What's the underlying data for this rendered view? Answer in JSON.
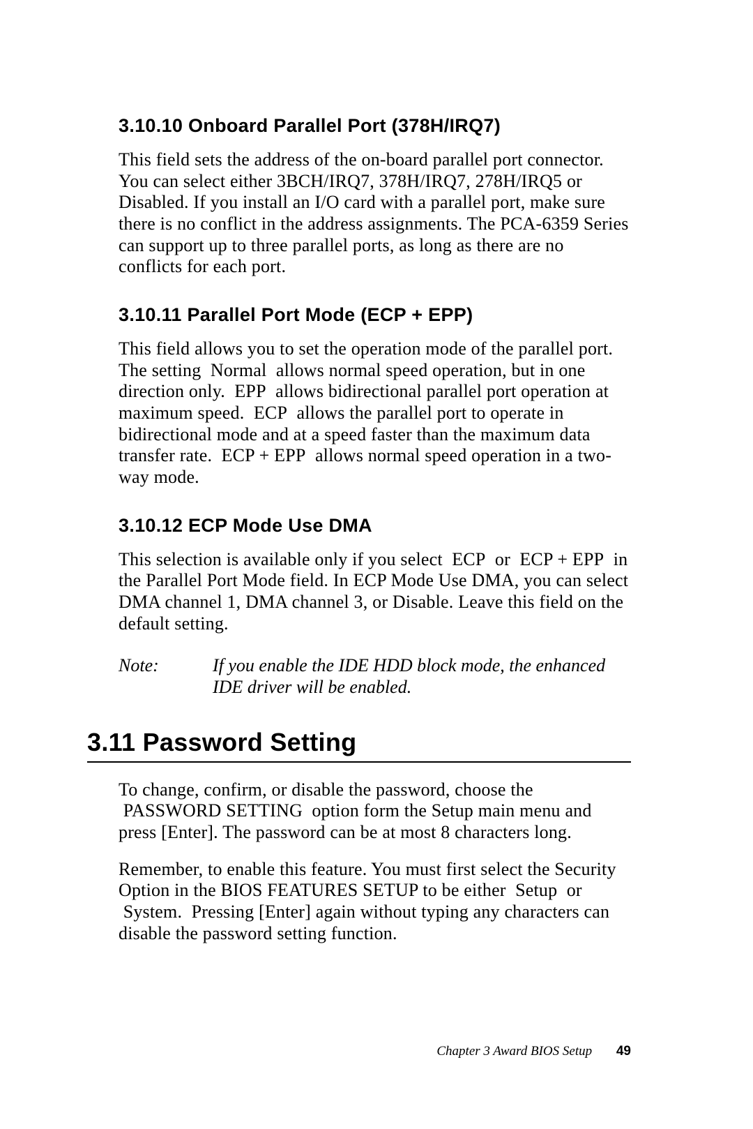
{
  "sections": {
    "s1": {
      "heading": "3.10.10 Onboard Parallel Port (378H/IRQ7)",
      "body": "This field sets the address of the on-board parallel port connector. You can select either 3BCH/IRQ7, 378H/IRQ7, 278H/IRQ5 or Disabled. If you install an I/O card with a parallel port, make sure there is no conflict in the address assignments. The PCA-6359 Series can support up to three parallel ports, as long as there are no conflicts for each port."
    },
    "s2": {
      "heading": "3.10.11 Parallel Port Mode (ECP + EPP)",
      "body": "This field allows you to set  the operation mode of the parallel port. The setting  Normal  allows normal speed operation, but in one direction only.  EPP  allows bidirectional parallel port operation at maximum speed.  ECP  allows the parallel port to operate in bidirectional mode and at a speed faster than the maximum data transfer rate.  ECP + EPP  allows normal speed operation in a two-way mode."
    },
    "s3": {
      "heading": "3.10.12 ECP Mode Use DMA",
      "body": "This selection is available only if you select  ECP  or  ECP + EPP  in the Parallel Port Mode field. In ECP Mode Use DMA, you can select DMA channel 1, DMA channel 3, or Disable. Leave this field on the default setting."
    },
    "note": {
      "label": "Note:",
      "text": "If you enable the IDE HDD block mode, the enhanced IDE driver will be enabled."
    },
    "s4": {
      "heading": "3.11  Password Setting",
      "body1": "To change, confirm, or disable the password, choose the  PASSWORD SETTING  option form the Setup main menu and press [Enter]. The password can be at most 8 characters long.",
      "body2": "Remember, to enable this feature. You must first select the Security Option in the BIOS FEATURES SETUP to be either  Setup  or  System.   Pressing [Enter] again without typing any characters can disable the password setting function."
    }
  },
  "footer": {
    "chapter": "Chapter 3  Award BIOS Setup",
    "page": "49"
  }
}
